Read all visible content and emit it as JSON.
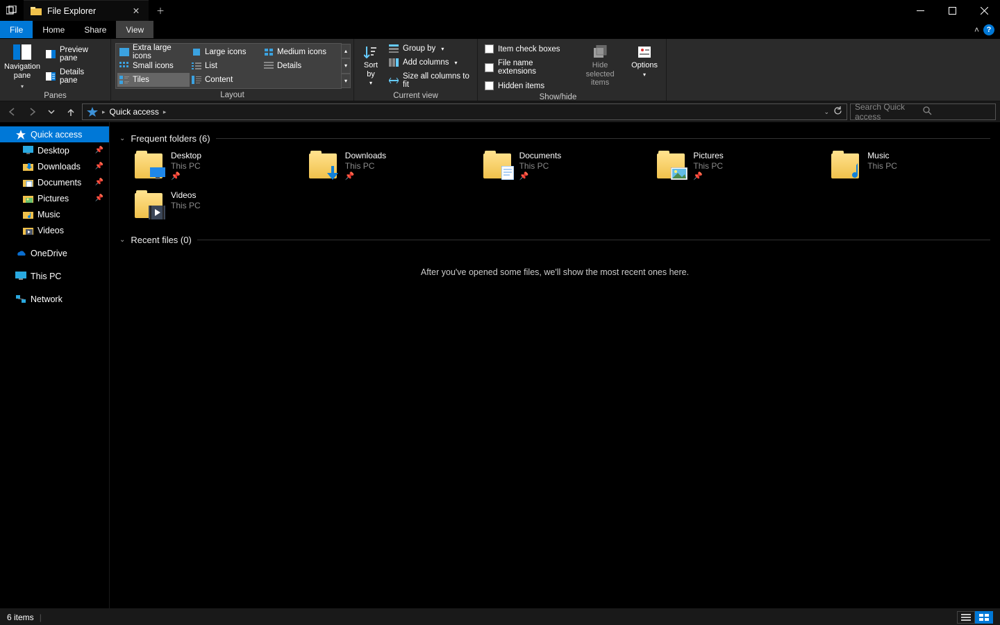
{
  "window": {
    "title": "File Explorer"
  },
  "ribbonTabs": {
    "file": "File",
    "home": "Home",
    "share": "Share",
    "view": "View"
  },
  "ribbon": {
    "panes": {
      "title": "Panes",
      "navigation": "Navigation pane",
      "preview": "Preview pane",
      "details": "Details pane"
    },
    "layout": {
      "title": "Layout",
      "opts": {
        "extra_large": "Extra large icons",
        "large": "Large icons",
        "medium": "Medium icons",
        "small": "Small icons",
        "list": "List",
        "details": "Details",
        "tiles": "Tiles",
        "content": "Content"
      }
    },
    "currentView": {
      "title": "Current view",
      "sortBy": "Sort by",
      "groupBy": "Group by",
      "addColumns": "Add columns",
      "sizeAll": "Size all columns to fit"
    },
    "showHide": {
      "title": "Show/hide",
      "itemCheck": "Item check boxes",
      "fileExt": "File name extensions",
      "hidden": "Hidden items",
      "hideSelected": "Hide selected items",
      "options": "Options"
    }
  },
  "address": {
    "location": "Quick access"
  },
  "search": {
    "placeholder": "Search Quick access"
  },
  "sidebar": {
    "quickAccess": "Quick access",
    "desktop": "Desktop",
    "downloads": "Downloads",
    "documents": "Documents",
    "pictures": "Pictures",
    "music": "Music",
    "videos": "Videos",
    "onedrive": "OneDrive",
    "thisPC": "This PC",
    "network": "Network"
  },
  "content": {
    "frequentTitle": "Frequent folders (6)",
    "recentTitle": "Recent files (0)",
    "recentEmpty": "After you've opened some files, we'll show the most recent ones here.",
    "folders": [
      {
        "name": "Desktop",
        "sub": "This PC",
        "pinned": true
      },
      {
        "name": "Downloads",
        "sub": "This PC",
        "pinned": true
      },
      {
        "name": "Documents",
        "sub": "This PC",
        "pinned": true
      },
      {
        "name": "Pictures",
        "sub": "This PC",
        "pinned": true
      },
      {
        "name": "Music",
        "sub": "This PC",
        "pinned": false
      },
      {
        "name": "Videos",
        "sub": "This PC",
        "pinned": false
      }
    ]
  },
  "status": {
    "items": "6 items"
  }
}
